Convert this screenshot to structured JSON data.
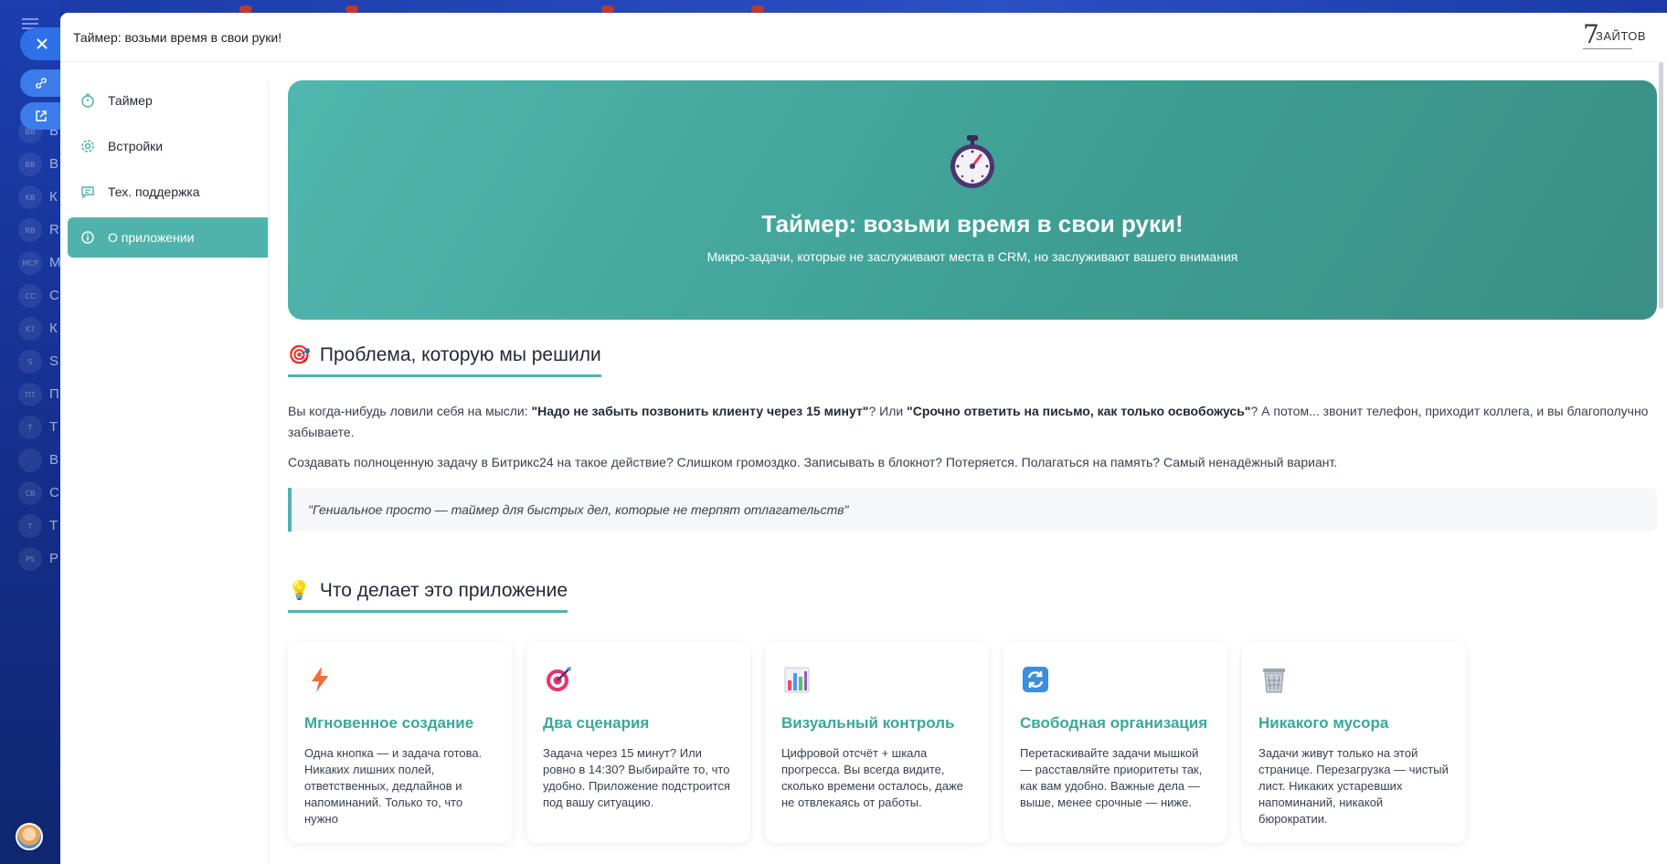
{
  "window": {
    "title": "Таймер: возьми время в свои руки!",
    "brand": "ЗАЙТОВ"
  },
  "background": {
    "letters": [
      "В",
      "В",
      "К",
      "R",
      "М",
      "С",
      "К",
      "S",
      "П",
      "Т",
      "В",
      "С",
      "Т",
      "Р"
    ],
    "avatars": [
      "BB",
      "BB",
      "KB",
      "RB",
      "MCP",
      "CC",
      "K7",
      "S",
      "ПТ",
      "T",
      "",
      "CB",
      "T",
      "РS"
    ]
  },
  "nav": {
    "items": [
      {
        "label": "Таймер",
        "icon": "stopwatch-icon"
      },
      {
        "label": "Встройки",
        "icon": "gear-icon"
      },
      {
        "label": "Тех. поддержка",
        "icon": "chat-icon"
      },
      {
        "label": "О приложении",
        "icon": "info-icon"
      }
    ]
  },
  "hero": {
    "title": "Таймер: возьми время в свои руки!",
    "subtitle": "Микро-задачи, которые не заслуживают места в CRM, но заслуживают вашего внимания"
  },
  "problem": {
    "heading": "Проблема, которую мы решили",
    "p1_a": "Вы когда-нибудь ловили себя на мысли: ",
    "p1_b": "\"Надо не забыть позвонить клиенту через 15 минут\"",
    "p1_c": "? Или ",
    "p1_d": "\"Срочно ответить на письмо, как только освобожусь\"",
    "p1_e": "? А потом... звонит телефон, приходит коллега, и вы благополучно забываете.",
    "p2": "Создавать полноценную задачу в Битрикс24 на такое действие? Слишком громоздко. Записывать в блокнот? Потеряется. Полагаться на память? Самый ненадёжный вариант.",
    "quote": "\"Гениальное просто — таймер для быстрых дел, которые не терпят отлагательств\""
  },
  "features": {
    "heading": "Что делает это приложение",
    "cards": [
      {
        "title": "Мгновенное создание",
        "text": "Одна кнопка — и задача готова. Никаких лишних полей, ответственных, дедлайнов и напоминаний. Только то, что нужно",
        "icon": "lightning-icon"
      },
      {
        "title": "Два сценария",
        "text": "Задача через 15 минут? Или ровно в 14:30? Выбирайте то, что удобно. Приложение подстроится под вашу ситуацию.",
        "icon": "target-icon"
      },
      {
        "title": "Визуальный контроль",
        "text": "Цифровой отсчёт + шкала прогресса. Вы всегда видите, сколько времени осталось, даже не отвлекаясь от работы.",
        "icon": "bar-chart-icon"
      },
      {
        "title": "Свободная организация",
        "text": "Перетаскивайте задачи мышкой — расставляйте приоритеты так, как вам удобно. Важные дела — выше, менее срочные — ниже.",
        "icon": "refresh-icon"
      },
      {
        "title": "Никакого мусора",
        "text": "Задачи живут только на этой странице. Перезагрузка — чистый лист. Никаких устаревших напоминаний, никакой бюрократии.",
        "icon": "trash-icon"
      }
    ]
  }
}
